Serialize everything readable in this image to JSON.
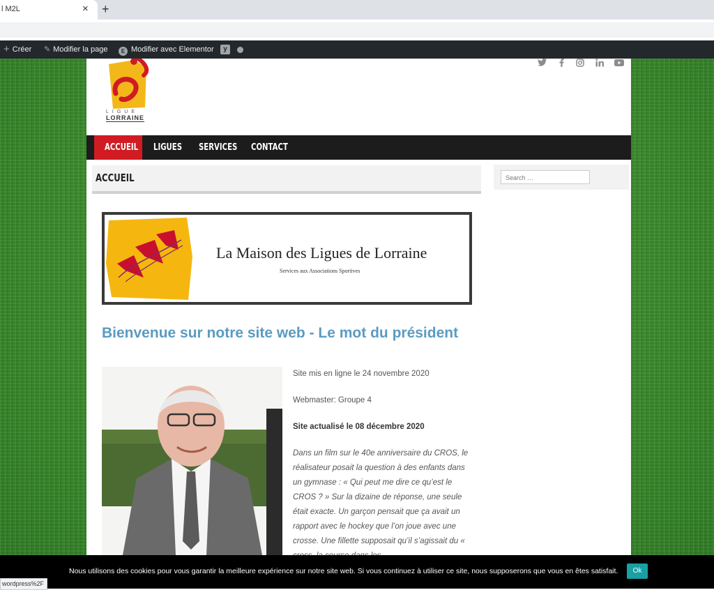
{
  "browser": {
    "tab_title": "l M2L",
    "tab_close": "×",
    "new_tab": "+"
  },
  "admin_bar": {
    "create": "Créer",
    "edit_page": "Modifier la page",
    "edit_elementor": "Modifier avec Elementor"
  },
  "site": {
    "logo_line1": "LIGUE",
    "logo_line2": "LORRAINE",
    "nav": [
      "ACCUEIL",
      "LIGUES",
      "SERVICES",
      "CONTACT"
    ],
    "page_title": "ACCUEIL",
    "search_placeholder": "Search …",
    "banner_title": "La Maison des Ligues de Lorraine",
    "banner_subtitle": "Services aux Associations Sportives",
    "welcome_heading": "Bienvenue sur notre site web - Le mot du président",
    "text": {
      "online": "Site mis en ligne le 24 novembre 2020",
      "webmaster": "Webmaster: Groupe 4",
      "updated": "Site actualisé le 08 décembre 2020",
      "paragraph": "Dans un film sur le 40e anniversaire du CROS, le réalisateur posait la question à des enfants dans un gymnase : « Qui peut me dire ce qu’est le CROS ? » Sur la dizaine de réponse, une seule était exacte. Un garçon pensait que ça avait un rapport avec le hockey que l’on joue avec une crosse. Une fillette supposait qu’il s’agissait du « cross, la course dans les..."
    }
  },
  "cookie": {
    "message": "Nous utilisons des cookies pour vous garantir la meilleure expérience sur notre site web. Si vous continuez à utiliser ce site, nous supposerons que vous en êtes satisfait.",
    "ok": "Ok"
  },
  "status_url": "wordpress%2F"
}
